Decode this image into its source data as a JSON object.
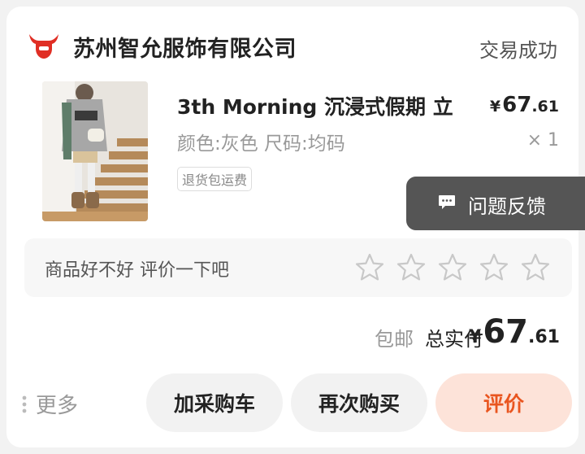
{
  "shop": {
    "name": "苏州智允服饰有限公司",
    "logo_icon": "bull-head-icon",
    "logo_color": "#e02e24"
  },
  "order": {
    "status": "交易成功"
  },
  "product": {
    "title": "3th Morning 沉浸式假期 立",
    "price_symbol": "¥",
    "price_int": "67",
    "price_dec": ".61",
    "spec": "颜色:灰色 尺码:均码",
    "quantity": "× 1",
    "tag": "退货包运费"
  },
  "feedback": {
    "label": "问题反馈",
    "icon": "chat-bubble-icon"
  },
  "review_prompt": {
    "text": "商品好不好 评价一下吧",
    "stars_total": 5,
    "rating": 0
  },
  "summary": {
    "shipping": "包邮",
    "total_label": "总实付",
    "total_symbol": "¥",
    "total_int": "67",
    "total_dec": ".61"
  },
  "actions": {
    "more": "更多",
    "add_cart": "加采购车",
    "rebuy": "再次购买",
    "review": "评价",
    "review_color": "#e9551f"
  }
}
